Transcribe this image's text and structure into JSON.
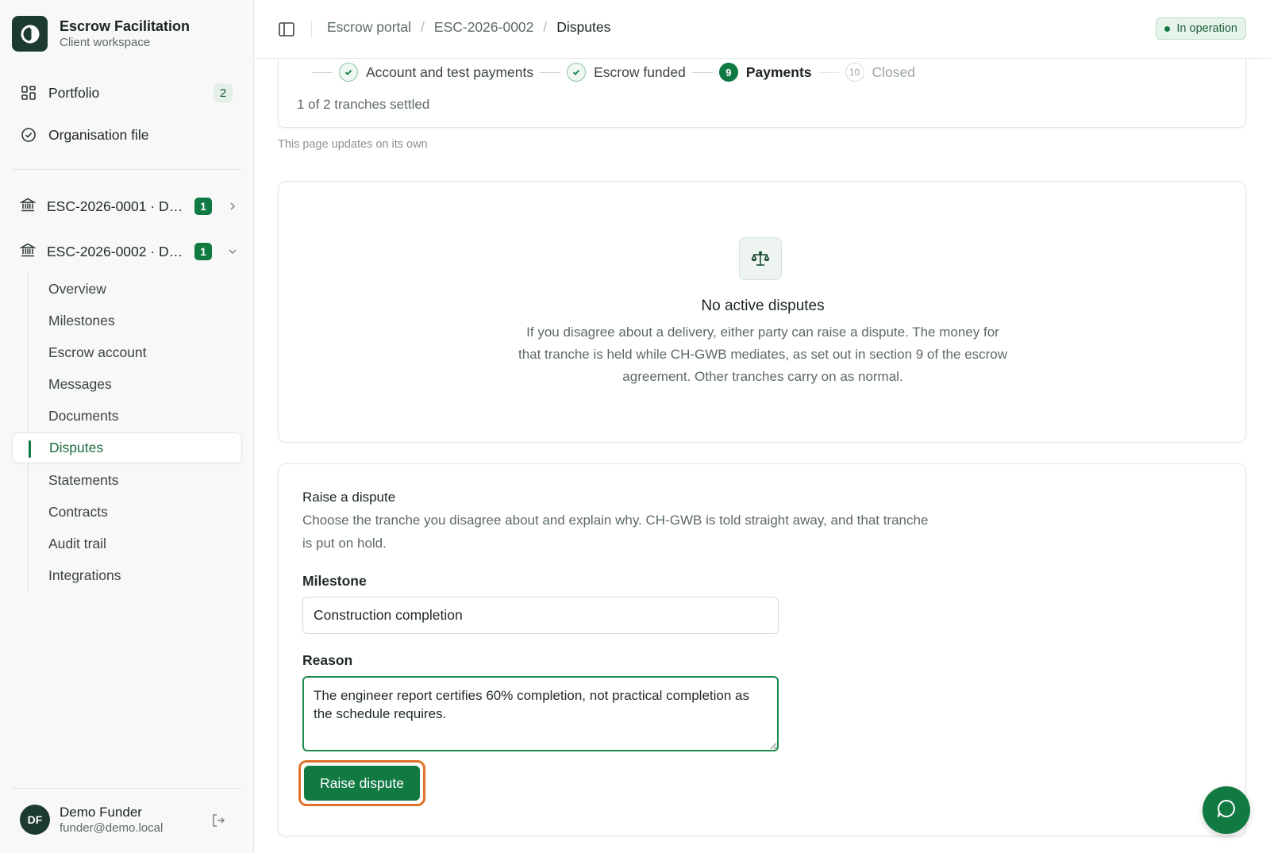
{
  "brand": {
    "name": "Escrow Facilitation",
    "subtitle": "Client workspace"
  },
  "sidebar": {
    "top_items": [
      {
        "label": "Portfolio",
        "icon": "grid-icon",
        "count": "2"
      },
      {
        "label": "Organisation file",
        "icon": "check-circle-icon"
      }
    ],
    "escrows": [
      {
        "label": "ESC-2026-0001 · D…",
        "badge": "1",
        "icon": "bank-icon",
        "chevron": "chevron-right-icon"
      },
      {
        "label": "ESC-2026-0002 · D…",
        "badge": "1",
        "icon": "bank-icon",
        "chevron": "chevron-down-icon"
      }
    ],
    "sub_items": [
      {
        "label": "Overview"
      },
      {
        "label": "Milestones"
      },
      {
        "label": "Escrow account"
      },
      {
        "label": "Messages"
      },
      {
        "label": "Documents"
      },
      {
        "label": "Disputes",
        "active": true
      },
      {
        "label": "Statements"
      },
      {
        "label": "Contracts"
      },
      {
        "label": "Audit trail"
      },
      {
        "label": "Integrations"
      }
    ],
    "user": {
      "initials": "DF",
      "name": "Demo Funder",
      "email": "funder@demo.local"
    }
  },
  "header": {
    "breadcrumb": [
      "Escrow portal",
      "ESC-2026-0002",
      "Disputes"
    ],
    "status": "In operation"
  },
  "progress": {
    "steps": [
      {
        "label": "Account and test payments",
        "state": "done"
      },
      {
        "label": "Escrow funded",
        "state": "done"
      },
      {
        "label": "Payments",
        "state": "current",
        "number": "9"
      },
      {
        "label": "Closed",
        "state": "future",
        "number": "10"
      }
    ],
    "tranche_status": "1 of 2 tranches settled",
    "update_note": "This page updates on its own"
  },
  "empty_state": {
    "icon": "scale-icon",
    "title": "No active disputes",
    "description": "If you disagree about a delivery, either party can raise a dispute. The money for that tranche is held while CH-GWB mediates, as set out in section 9 of the escrow agreement. Other tranches carry on as normal."
  },
  "form": {
    "title": "Raise a dispute",
    "description": "Choose the tranche you disagree about and explain why. CH-GWB is told straight away, and that tranche is put on hold.",
    "milestone_label": "Milestone",
    "milestone_value": "Construction completion",
    "reason_label": "Reason",
    "reason_value": "The engineer report certifies 60% completion, not practical completion as the schedule requires.",
    "submit_label": "Raise dispute"
  },
  "colors": {
    "accent": "#117a43",
    "brand_dark": "#1c3b2e",
    "highlight": "#e0722b"
  }
}
